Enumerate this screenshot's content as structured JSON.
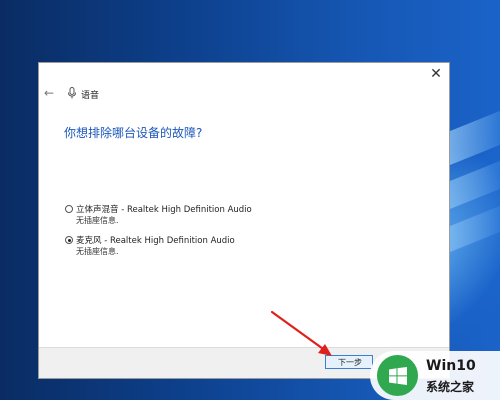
{
  "window": {
    "title": "语音",
    "close_label": "✕",
    "back_label": "←"
  },
  "dialog": {
    "heading": "你想排除哪台设备的故障?",
    "options": [
      {
        "label": "立体声混音 - Realtek High Definition Audio",
        "sub": "无插座信息.",
        "selected": false
      },
      {
        "label": "麦克风 - Realtek High Definition Audio",
        "sub": "无插座信息.",
        "selected": true
      }
    ],
    "next_label": "下一步"
  },
  "watermark": {
    "title": "Win10",
    "subtitle": "系统之家"
  },
  "colors": {
    "heading": "#1c57ba",
    "next_button_border": "#3c7fd1",
    "annotation_arrow": "#e0201b",
    "watermark_logo": "#2fa84f"
  }
}
